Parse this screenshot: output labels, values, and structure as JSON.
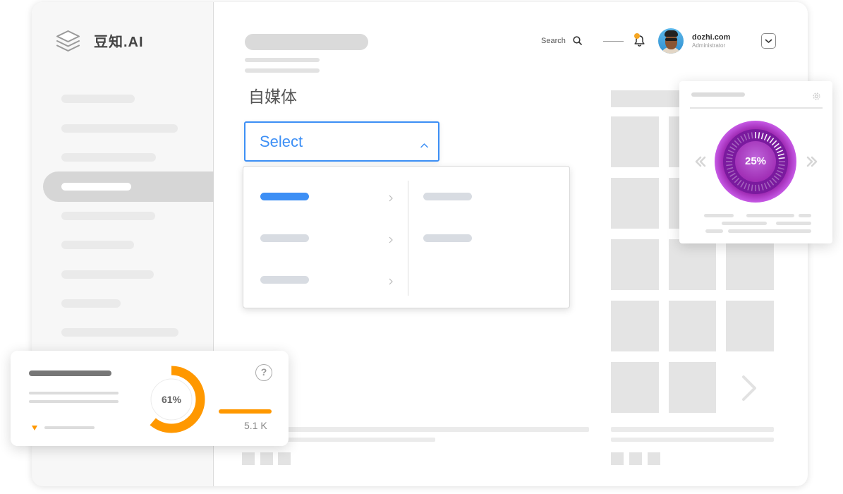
{
  "app": {
    "logo_text": "豆知.AI",
    "logo_icon": "layers-icon"
  },
  "header": {
    "search_label": "Search",
    "search_icon": "search-icon",
    "notification_icon": "bell-icon",
    "user": {
      "name": "dozhi.com",
      "role": "Administrator"
    },
    "account_menu_icon": "chevron-down-icon"
  },
  "main": {
    "section_title": "自媒体",
    "select": {
      "value": "Select",
      "toggle_icon": "chevron-up-icon",
      "expanded": true
    }
  },
  "gallery": {
    "next_icon": "chevron-right-icon"
  },
  "gauge_card": {
    "value": 0.25,
    "value_label": "25%",
    "prev_icon": "double-chevron-left-icon",
    "next_icon": "double-chevron-right-icon",
    "settings_icon": "gear-icon"
  },
  "stats_card": {
    "donut_value": 0.61,
    "donut_label": "61%",
    "metric_value": "5.1 K",
    "help_icon": "question-circle-icon",
    "trend_icon": "caret-down-icon"
  },
  "colors": {
    "accent": "#3d8ff5",
    "gauge_purple": "#9c27b0",
    "highlight_orange": "#ff9800"
  }
}
